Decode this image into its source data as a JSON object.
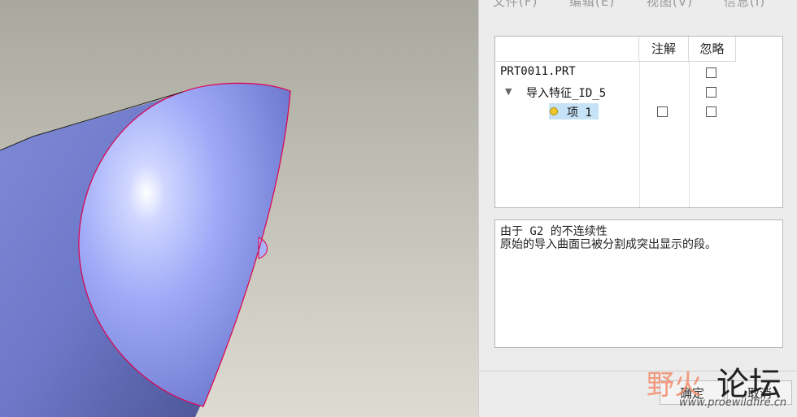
{
  "menu": {
    "file": "文件(F)",
    "edit": "编辑(E)",
    "view": "视图(V)",
    "info": "信息(I)"
  },
  "tree": {
    "columns": [
      "注解",
      "忽略"
    ],
    "rows": [
      {
        "label": "PRT0011.PRT",
        "annotate": null,
        "ignore": false
      },
      {
        "label": "导入特征_ID_5",
        "annotate": null,
        "ignore": false
      },
      {
        "label": "项 1",
        "annotate": false,
        "ignore": false
      }
    ]
  },
  "message": {
    "line1": "由于 G2 的不连续性",
    "line2": "原始的导入曲面已被分割成突出显示的段。"
  },
  "buttons": {
    "ok": "确定",
    "cancel": "取消"
  },
  "watermark": {
    "brand_left": "野火",
    "brand_right": "论坛",
    "url": "www.proewildfire.cn"
  },
  "colors": {
    "background_gradient_top": "#a9a89f",
    "background_gradient_bottom": "#dedcd2",
    "surface_blue": "#9aa6f4",
    "highlight_edge": "#e0004f",
    "selection": "#c5e2f6"
  }
}
